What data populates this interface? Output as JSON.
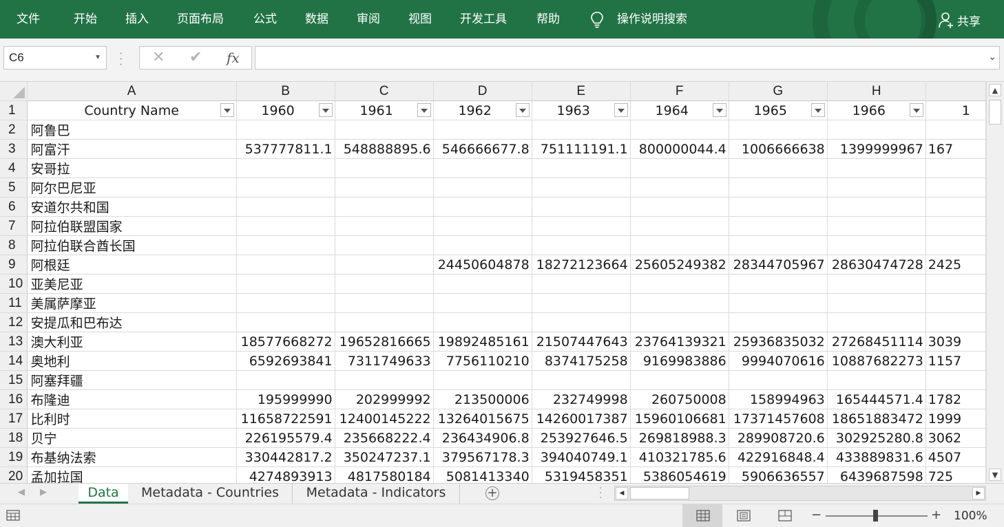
{
  "ribbon": {
    "tabs": [
      "文件",
      "开始",
      "插入",
      "页面布局",
      "公式",
      "数据",
      "审阅",
      "视图",
      "开发工具",
      "帮助"
    ],
    "tell_me": "操作说明搜索",
    "share": "共享",
    "color": "#217346"
  },
  "formula_bar": {
    "name_box": "C6",
    "cancel_icon": "✕",
    "enter_icon": "✔",
    "fx_label": "fx",
    "formula": ""
  },
  "columns": [
    "A",
    "B",
    "C",
    "D",
    "E",
    "F",
    "G",
    "H",
    ""
  ],
  "header_row": {
    "row": "1",
    "cells": [
      "Country Name",
      "1960",
      "1961",
      "1962",
      "1963",
      "1964",
      "1965",
      "1966",
      "1"
    ]
  },
  "rows": [
    {
      "n": "2",
      "name": "阿鲁巴",
      "v": [
        "",
        "",
        "",
        "",
        "",
        "",
        "",
        ""
      ]
    },
    {
      "n": "3",
      "name": "阿富汗",
      "v": [
        "537777811.1",
        "548888895.6",
        "546666677.8",
        "751111191.1",
        "800000044.4",
        "1006666638",
        "1399999967",
        "167"
      ]
    },
    {
      "n": "4",
      "name": "安哥拉",
      "v": [
        "",
        "",
        "",
        "",
        "",
        "",
        "",
        ""
      ]
    },
    {
      "n": "5",
      "name": "阿尔巴尼亚",
      "v": [
        "",
        "",
        "",
        "",
        "",
        "",
        "",
        ""
      ]
    },
    {
      "n": "6",
      "name": "安道尔共和国",
      "v": [
        "",
        "",
        "",
        "",
        "",
        "",
        "",
        ""
      ]
    },
    {
      "n": "7",
      "name": "阿拉伯联盟国家",
      "v": [
        "",
        "",
        "",
        "",
        "",
        "",
        "",
        ""
      ]
    },
    {
      "n": "8",
      "name": "阿拉伯联合酋长国",
      "v": [
        "",
        "",
        "",
        "",
        "",
        "",
        "",
        ""
      ]
    },
    {
      "n": "9",
      "name": "阿根廷",
      "v": [
        "",
        "",
        "24450604878",
        "18272123664",
        "25605249382",
        "28344705967",
        "28630474728",
        "2425"
      ]
    },
    {
      "n": "10",
      "name": "亚美尼亚",
      "v": [
        "",
        "",
        "",
        "",
        "",
        "",
        "",
        ""
      ]
    },
    {
      "n": "11",
      "name": "美属萨摩亚",
      "v": [
        "",
        "",
        "",
        "",
        "",
        "",
        "",
        ""
      ]
    },
    {
      "n": "12",
      "name": "安提瓜和巴布达",
      "v": [
        "",
        "",
        "",
        "",
        "",
        "",
        "",
        ""
      ]
    },
    {
      "n": "13",
      "name": "澳大利亚",
      "v": [
        "18577668272",
        "19652816665",
        "19892485161",
        "21507447643",
        "23764139321",
        "25936835032",
        "27268451114",
        "3039"
      ]
    },
    {
      "n": "14",
      "name": "奥地利",
      "v": [
        "6592693841",
        "7311749633",
        "7756110210",
        "8374175258",
        "9169983886",
        "9994070616",
        "10887682273",
        "1157"
      ]
    },
    {
      "n": "15",
      "name": "阿塞拜疆",
      "v": [
        "",
        "",
        "",
        "",
        "",
        "",
        "",
        ""
      ]
    },
    {
      "n": "16",
      "name": "布隆迪",
      "v": [
        "195999990",
        "202999992",
        "213500006",
        "232749998",
        "260750008",
        "158994963",
        "165444571.4",
        "1782"
      ]
    },
    {
      "n": "17",
      "name": "比利时",
      "v": [
        "11658722591",
        "12400145222",
        "13264015675",
        "14260017387",
        "15960106681",
        "17371457608",
        "18651883472",
        "1999"
      ]
    },
    {
      "n": "18",
      "name": "贝宁",
      "v": [
        "226195579.4",
        "235668222.4",
        "236434906.8",
        "253927646.5",
        "269818988.3",
        "289908720.6",
        "302925280.8",
        "3062"
      ]
    },
    {
      "n": "19",
      "name": "布基纳法索",
      "v": [
        "330442817.2",
        "350247237.1",
        "379567178.3",
        "394040749.1",
        "410321785.6",
        "422916848.4",
        "433889831.6",
        "4507"
      ]
    },
    {
      "n": "20",
      "name": "孟加拉国",
      "v": [
        "4274893913",
        "4817580184",
        "5081413340",
        "5319458351",
        "5386054619",
        "5906636557",
        "6439687598",
        "725"
      ]
    }
  ],
  "sheets": [
    "Data",
    "Metadata - Countries",
    "Metadata - Indicators"
  ],
  "active_sheet": "Data",
  "status": {
    "zoom": "100%",
    "zoom_minus": "−",
    "zoom_plus": "+"
  }
}
